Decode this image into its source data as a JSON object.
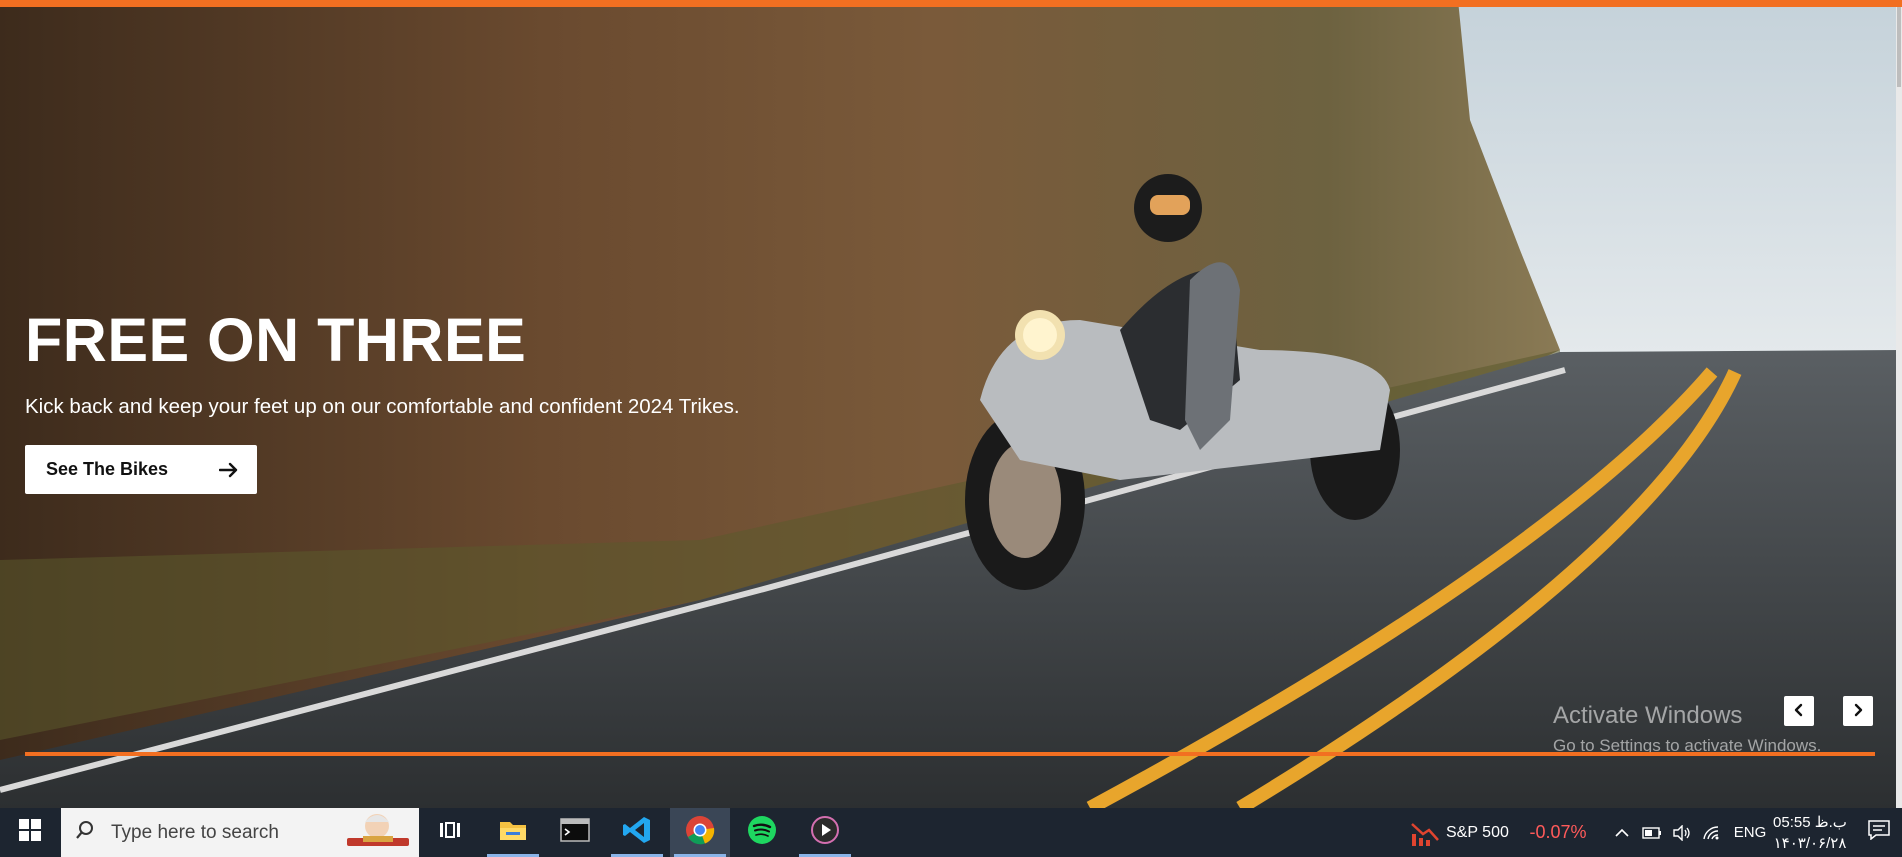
{
  "hero": {
    "title": "FREE ON THREE",
    "subtitle": "Kick back and keep your feet up on our comfortable and confident 2024 Trikes.",
    "cta_label": "See The Bikes",
    "cta_icon": "arrow-right-icon",
    "carousel_prev_icon": "chevron-left-icon",
    "carousel_next_icon": "chevron-right-icon",
    "accent_color": "#f26f21"
  },
  "watermark": {
    "line1": "Activate Windows",
    "line2": "Go to Settings to activate Windows."
  },
  "taskbar": {
    "search_placeholder": "Type here to search",
    "apps": [
      "task-view",
      "file-explorer",
      "terminal",
      "vs-code",
      "chrome",
      "spotify",
      "media-player"
    ],
    "active_app": "chrome",
    "stock_label": "S&P 500",
    "stock_change": "-0.07%",
    "language": "ENG",
    "time": "05:55 ب.ظ",
    "date": "۱۴۰۳/۰۶/۲۸"
  }
}
